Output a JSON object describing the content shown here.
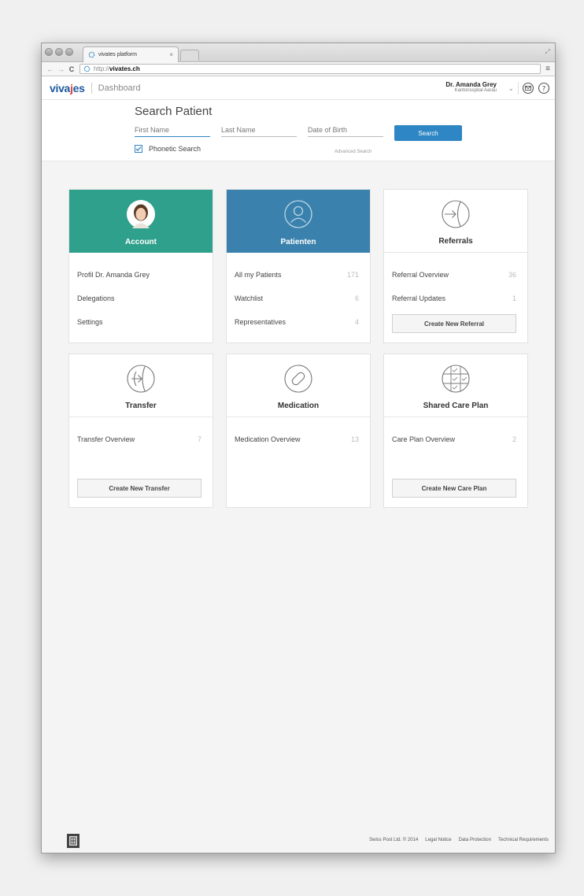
{
  "browser": {
    "tab_title": "vivates platform",
    "tab_close": "×",
    "url_protocol": "http://",
    "url_host": "vivates.ch"
  },
  "header": {
    "logo_left": "viva",
    "logo_accent": "j",
    "logo_right": "es",
    "title": "Dashboard",
    "user_name": "Dr. Amanda Grey",
    "user_org": "Kantonsspital Aarau"
  },
  "search": {
    "title": "Search Patient",
    "first_name_placeholder": "First Name",
    "last_name_placeholder": "Last Name",
    "dob_placeholder": "Date of Birth",
    "button": "Search",
    "phonetic_label": "Phonetic Search",
    "phonetic_checked": true,
    "advanced": "Advanced Search"
  },
  "cards": {
    "account": {
      "title": "Account",
      "items": [
        "Profil Dr. Amanda Grey",
        "Delegations",
        "Settings"
      ]
    },
    "patients": {
      "title": "Patienten",
      "items": [
        {
          "label": "All my Patients",
          "count": "171"
        },
        {
          "label": "Watchlist",
          "count": "6"
        },
        {
          "label": "Representatives",
          "count": "4"
        }
      ]
    },
    "referrals": {
      "title": "Referrals",
      "items": [
        {
          "label": "Referral Overview",
          "count": "36"
        },
        {
          "label": "Referral Updates",
          "count": "1"
        }
      ],
      "button": "Create New Referral"
    },
    "transfer": {
      "title": "Transfer",
      "items": [
        {
          "label": "Transfer Overview",
          "count": "7"
        }
      ],
      "button": "Create New Transfer"
    },
    "medication": {
      "title": "Medication",
      "items": [
        {
          "label": "Medication Overview",
          "count": "13"
        }
      ]
    },
    "careplan": {
      "title": "Shared Care Plan",
      "items": [
        {
          "label": "Care Plan Overview",
          "count": "2"
        }
      ],
      "button": "Create New Care Plan"
    }
  },
  "footer": {
    "copyright": "Swiss Post Ltd. © 2014",
    "legal": "Legal Notice",
    "privacy": "Data Protection",
    "tech": "Technical Requirements"
  },
  "colors": {
    "brand_blue": "#1e5aa0",
    "brand_red": "#e0403a",
    "account_green": "#2fa08b",
    "patients_blue": "#3a82ad",
    "button_blue": "#2f86c4"
  }
}
